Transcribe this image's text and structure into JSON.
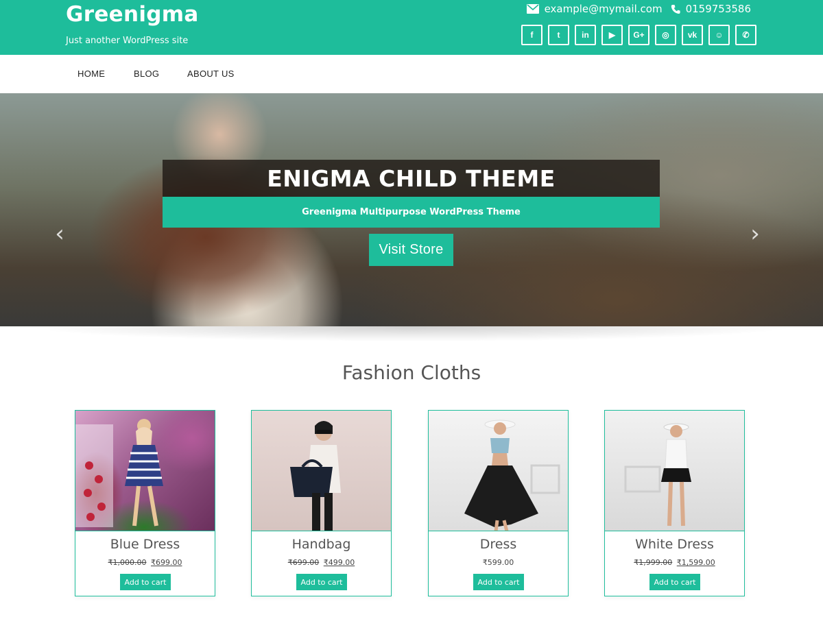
{
  "header": {
    "title": "Greenigma",
    "tagline": "Just another WordPress site",
    "email": "example@mymail.com",
    "phone": "0159753586",
    "accent_color": "#1ebd9b",
    "socials": [
      {
        "name": "facebook-icon",
        "glyph": "f"
      },
      {
        "name": "twitter-icon",
        "glyph": "t"
      },
      {
        "name": "linkedin-icon",
        "glyph": "in"
      },
      {
        "name": "youtube-icon",
        "glyph": "▶"
      },
      {
        "name": "google-plus-icon",
        "glyph": "G+"
      },
      {
        "name": "instagram-icon",
        "glyph": "◎"
      },
      {
        "name": "vk-icon",
        "glyph": "vk"
      },
      {
        "name": "snapchat-icon",
        "glyph": "☺"
      },
      {
        "name": "whatsapp-icon",
        "glyph": "✆"
      }
    ]
  },
  "nav": {
    "items": [
      "HOME",
      "BLOG",
      "ABOUT US"
    ]
  },
  "hero": {
    "title": "ENIGMA CHILD THEME",
    "subtitle": "Greenigma Multipurpose WordPress Theme",
    "button": "Visit Store",
    "prev_icon": "chevron-left-icon",
    "next_icon": "chevron-right-icon"
  },
  "section": {
    "title": "Fashion Cloths"
  },
  "products": [
    {
      "name": "Blue Dress",
      "old_price": "₹1,000.00",
      "price": "₹699.00",
      "button": "Add to cart"
    },
    {
      "name": "Handbag",
      "old_price": "₹699.00",
      "price": "₹499.00",
      "button": "Add to cart"
    },
    {
      "name": "Dress",
      "old_price": "",
      "price": "₹599.00",
      "button": "Add to cart"
    },
    {
      "name": "White Dress",
      "old_price": "₹1,999.00",
      "price": "₹1,599.00",
      "button": "Add to cart"
    }
  ]
}
